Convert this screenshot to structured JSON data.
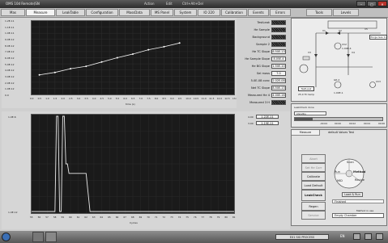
{
  "window": {
    "title": "OMS 10d Remote(SN",
    "center_items": [
      "Action",
      "Edit",
      "Ctrl+Alt+Del"
    ]
  },
  "tabs": [
    "Mas",
    "Measure",
    "LeakTable",
    "Configuration",
    "MassData",
    "MS Panel",
    "System",
    "IO 220",
    "Calibration",
    "Events",
    "Errors",
    "Tools",
    "Levels"
  ],
  "upper_chart": {
    "y_ticks": [
      "1.2E-11",
      "1.1E-11",
      "1.0E-11",
      "9.0E-12",
      "8.0E-12",
      "7.0E-12",
      "6.0E-12",
      "5.0E-12",
      "4.0E-12",
      "3.0E-12",
      "2.0E-12",
      "1.0E-12",
      "0.0"
    ],
    "x_ticks": [
      "0.0",
      "0.5",
      "1.0",
      "1.5",
      "2.0",
      "2.5",
      "3.0",
      "3.5",
      "4.0",
      "4.5",
      "5.0",
      "5.5",
      "6.0",
      "6.5",
      "7.0",
      "7.5",
      "8.0",
      "8.5",
      "9.0",
      "9.5",
      "10.0",
      "10.5",
      "11.0",
      "11.5",
      "12.0",
      "12.5",
      "13.0"
    ],
    "xlabel": "time (s)"
  },
  "lower_chart": {
    "y_top": "1.0E-6",
    "y_bottom": "1.0E-12",
    "x_ticks": [
      "55",
      "56",
      "57",
      "58",
      "59",
      "60",
      "61",
      "62",
      "63",
      "64",
      "65",
      "66",
      "67",
      "68",
      "69",
      "70",
      "71",
      "72",
      "73",
      "74",
      "75",
      "76",
      "77",
      "78",
      "79",
      "80",
      "81"
    ],
    "xlabel": "Cycles"
  },
  "status": [
    {
      "label": "TestLeak",
      "value": ""
    },
    {
      "label": "He Sample",
      "value": ""
    },
    {
      "label": "Background",
      "value": ""
    },
    {
      "label": "Sample 2",
      "value": ""
    },
    {
      "label": "He TC Slope",
      "value": "8.50E-13"
    },
    {
      "label": "He Sample Slope",
      "value": "8.05E-4"
    },
    {
      "label": "He BG Slope",
      "value": "1.50E-10"
    },
    {
      "label": "Sel mass",
      "value": "7.0"
    },
    {
      "label": "5.0E-08 conc",
      "value": "2.02E-08"
    },
    {
      "label": "Net TC Slope",
      "value": "8.50E-13"
    },
    {
      "label": "Measured He 4",
      "value": "4.00E-16"
    },
    {
      "label": "Measured 3 H",
      "value": ""
    }
  ],
  "readouts": [
    {
      "label": "4.00",
      "value": "1.22E-11"
    },
    {
      "label": "3.00",
      "value": "1.19E-11"
    }
  ],
  "schematic": {
    "labels": [
      "V1",
      "V2",
      "V5",
      "Purge Gas In",
      "Ch2",
      "1.00E-4",
      "V3",
      "V4",
      "TestLeak",
      "25.0 TC temp",
      "GR 2",
      "1.00E-1",
      "Ch3"
    ],
    "leakcheck_title": "LeakCheck done",
    "mode": "standby",
    "scale": [
      "-00:04",
      "00:00",
      "00:02",
      "00:04",
      "00:06"
    ]
  },
  "controls": {
    "tab_labels": [
      "Measure",
      "default Values Test"
    ],
    "buttons": [
      "Abort",
      "Set He Corr",
      "Calibrate",
      "Load Default",
      "LeakCheck",
      "Regen",
      "Service"
    ],
    "method_words": [
      "Scan",
      "Run",
      "Method",
      "Recipe",
      "MID"
    ],
    "load_run": "Load & Run",
    "finished": "Finished",
    "method_in_use_label": "Method in use",
    "method_in_use": "Empty Chamber"
  },
  "taskbar": {
    "status": "EX1 SIG PROCESS",
    "lang": "EN"
  },
  "chart_data": [
    {
      "type": "line",
      "x": [
        0.5,
        1.5,
        2.5,
        3.5,
        4.5,
        5.5,
        6.5,
        7.5,
        8.5,
        9.5
      ],
      "y": [
        3.2e-12,
        3.6e-12,
        4.2e-12,
        4.6e-12,
        5.3e-12,
        6e-12,
        6.6e-12,
        7.3e-12,
        7.8e-12,
        8.4e-12
      ],
      "xlabel": "time (s)",
      "xlim": [
        0,
        13
      ],
      "ylim": [
        0,
        1.2e-11
      ]
    },
    {
      "type": "line",
      "x": [
        55,
        57.5,
        58,
        58.2,
        58.4,
        58.6,
        58.8,
        59,
        59.2,
        59.4,
        59.6,
        59.8,
        60,
        60.5,
        61,
        62,
        62.5,
        63,
        81
      ],
      "y": [
        0,
        0,
        0,
        1,
        1,
        0,
        0,
        1,
        1,
        0.5,
        0.5,
        0.4,
        0.4,
        0.4,
        0.4,
        0.4,
        0,
        0,
        0
      ],
      "xlabel": "Cycles",
      "xlim": [
        55,
        81
      ]
    }
  ]
}
